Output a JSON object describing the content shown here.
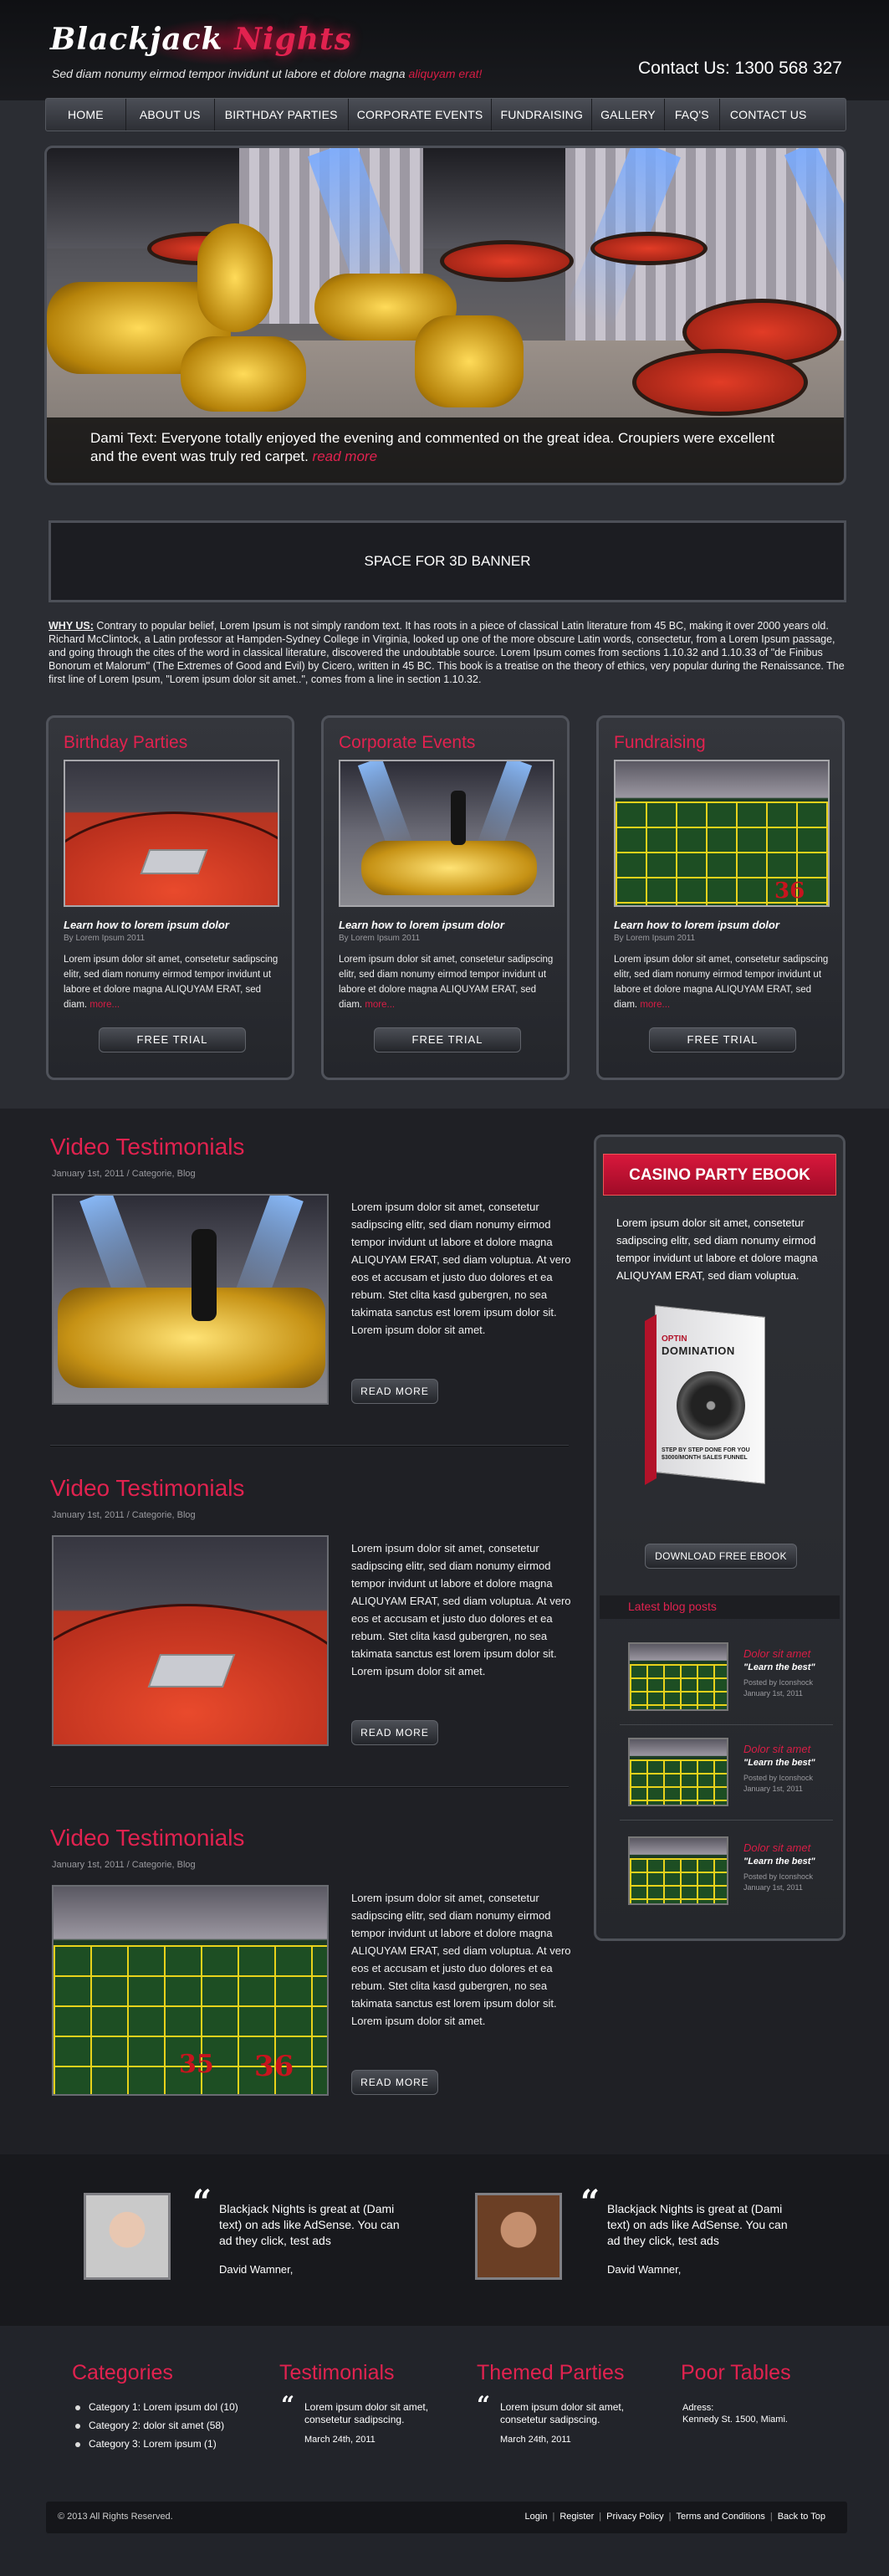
{
  "header": {
    "logo_main": "Blackjack",
    "logo_accent": "Nights",
    "tagline": "Sed diam nonumy eirmod tempor invidunt ut labore et dolore magna",
    "tagline_accent": "aliquyam erat!",
    "contact": "Contact Us: 1300 568 327"
  },
  "nav": [
    "HOME",
    "ABOUT US",
    "BIRTHDAY PARTIES",
    "CORPORATE EVENTS",
    "FUNDRAISING",
    "GALLERY",
    "FAQ'S",
    "CONTACT US"
  ],
  "hero": {
    "caption": "Dami Text: Everyone totally enjoyed the evening and commented on the great idea. Croupiers were excellent and the event was truly red carpet.",
    "read_more": "read more"
  },
  "banner": "SPACE FOR 3D BANNER",
  "why": {
    "label": "WHY US:",
    "text": "Contrary to popular belief, Lorem Ipsum is not simply random text. It has roots in a piece of classical Latin literature from 45 BC, making it over 2000 years old. Richard McClintock, a Latin professor at Hampden-Sydney College in Virginia, looked up one of the more obscure Latin words, consectetur, from a Lorem Ipsum passage, and going through the cites of the word in classical literature, discovered the undoubtable source. Lorem Ipsum comes from sections 1.10.32 and 1.10.33 of \"de Finibus Bonorum et Malorum\" (The Extremes of Good and Evil) by Cicero, written in 45 BC. This book is a treatise on the theory of ethics, very popular during the Renaissance. The first line of Lorem Ipsum, \"Lorem ipsum dolor sit amet..\", comes from a line in section 1.10.32."
  },
  "cards": [
    {
      "title": "Birthday Parties",
      "heading": "Learn how to lorem ipsum dolor",
      "by": "By Lorem Ipsum 2011",
      "text": "Lorem ipsum dolor sit amet, consetetur sadipscing elitr, sed diam nonumy eirmod tempor invidunt ut labore et dolore magna ALIQUYAM ERAT, sed diam.",
      "more": "more...",
      "button": "FREE TRIAL"
    },
    {
      "title": "Corporate Events",
      "heading": "Learn how to lorem ipsum dolor",
      "by": "By Lorem Ipsum 2011",
      "text": "Lorem ipsum dolor sit amet, consetetur sadipscing elitr, sed diam nonumy eirmod tempor invidunt ut labore et dolore magna ALIQUYAM ERAT, sed diam.",
      "more": "more...",
      "button": "FREE TRIAL"
    },
    {
      "title": "Fundraising",
      "heading": "Learn how to lorem ipsum dolor",
      "by": "By Lorem Ipsum 2011",
      "text": "Lorem ipsum dolor sit amet, consetetur sadipscing elitr, sed diam nonumy eirmod tempor invidunt ut labore et dolore magna ALIQUYAM ERAT, sed diam.",
      "more": "more...",
      "button": "FREE TRIAL"
    }
  ],
  "videos": [
    {
      "title": "Video Testimonials",
      "date": "January 1st, 2011 / Categorie, Blog",
      "text": "Lorem ipsum dolor sit amet, consetetur sadipscing elitr, sed diam nonumy eirmod tempor invidunt ut labore et dolore magna ALIQUYAM ERAT, sed diam voluptua. At vero eos et accusam et justo duo dolores et ea rebum. Stet clita kasd gubergren, no sea takimata sanctus est lorem ipsum dolor sit. Lorem ipsum dolor sit amet.",
      "button": "READ MORE"
    },
    {
      "title": "Video Testimonials",
      "date": "January 1st, 2011 / Categorie, Blog",
      "text": "Lorem ipsum dolor sit amet, consetetur sadipscing elitr, sed diam nonumy eirmod tempor invidunt ut labore et dolore magna ALIQUYAM ERAT, sed diam voluptua. At vero eos et accusam et justo duo dolores et ea rebum. Stet clita kasd gubergren, no sea takimata sanctus est lorem ipsum dolor sit. Lorem ipsum dolor sit amet.",
      "button": "READ MORE"
    },
    {
      "title": "Video Testimonials",
      "date": "January 1st, 2011 / Categorie, Blog",
      "text": "Lorem ipsum dolor sit amet, consetetur sadipscing elitr, sed diam nonumy eirmod tempor invidunt ut labore et dolore magna ALIQUYAM ERAT, sed diam voluptua. At vero eos et accusam et justo duo dolores et ea rebum. Stet clita kasd gubergren, no sea takimata sanctus est lorem ipsum dolor sit. Lorem ipsum dolor sit amet.",
      "button": "READ MORE"
    }
  ],
  "sidebar": {
    "title": "CASINO PARTY EBOOK",
    "text": "Lorem ipsum dolor sit amet, consetetur sadipscing elitr, sed diam nonumy eirmod tempor invidunt ut labore et dolore magna ALIQUYAM ERAT, sed diam voluptua.",
    "ebook_brand_top": "OPTIN",
    "ebook_brand": "DOMINATION",
    "ebook_sub": "STEP BY STEP DONE FOR YOU $3000/MONTH SALES FUNNEL",
    "download": "DOWNLOAD FREE EBOOK",
    "blog_heading": "Latest blog posts",
    "posts": [
      {
        "title": "Dolor sit amet",
        "quote": "\"Learn the best\"",
        "meta1": "Posted by Iconshock",
        "meta2": "January 1st, 2011"
      },
      {
        "title": "Dolor sit amet",
        "quote": "\"Learn the best\"",
        "meta1": "Posted by Iconshock",
        "meta2": "January 1st, 2011"
      },
      {
        "title": "Dolor sit amet",
        "quote": "\"Learn the best\"",
        "meta1": "Posted by Iconshock",
        "meta2": "January 1st, 2011"
      }
    ]
  },
  "quotes": [
    {
      "text": "Blackjack Nights is great at (Dami text) on ads like AdSense. You can ad they click, test ads",
      "name": "David Wamner,"
    },
    {
      "text": "Blackjack Nights is great at (Dami text) on ads like AdSense. You can ad they click, test ads",
      "name": "David Wamner,"
    }
  ],
  "footer": {
    "categories": {
      "title": "Categories",
      "items": [
        "Category 1: Lorem ipsum dol (10)",
        "Category 2: dolor sit amet (58)",
        "Category 3: Lorem ipsum (1)"
      ]
    },
    "testimonials": {
      "title": "Testimonials",
      "text": "Lorem ipsum dolor sit amet, consetetur sadipscing.",
      "date": "March 24th, 2011"
    },
    "themed": {
      "title": "Themed Parties",
      "text": "Lorem ipsum dolor sit amet, consetetur sadipscing.",
      "date": "March 24th, 2011"
    },
    "poor": {
      "title": "Poor Tables",
      "addr_label": "Adress:",
      "addr": "Kennedy St. 1500, Miami."
    },
    "copyright": "© 2013 All Rights Reserved.",
    "links": [
      "Login",
      "Register",
      "Privacy Policy",
      "Terms and Conditions",
      "Back to Top"
    ]
  },
  "colors": {
    "accent": "#e1224f",
    "background": "#2b2d33",
    "header": "#0f1013"
  }
}
